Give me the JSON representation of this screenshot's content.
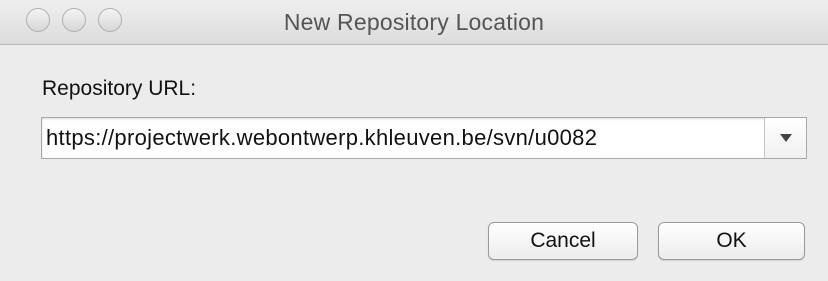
{
  "window": {
    "title": "New Repository Location"
  },
  "form": {
    "url_label": "Repository URL:",
    "url_value": "https://projectwerk.webontwerp.khleuven.be/svn/u0082"
  },
  "buttons": {
    "cancel_label": "Cancel",
    "ok_label": "OK"
  },
  "icons": {
    "window_controls": [
      "close-icon",
      "minimize-icon",
      "zoom-icon"
    ],
    "combo_arrow": "chevron-down-icon"
  }
}
